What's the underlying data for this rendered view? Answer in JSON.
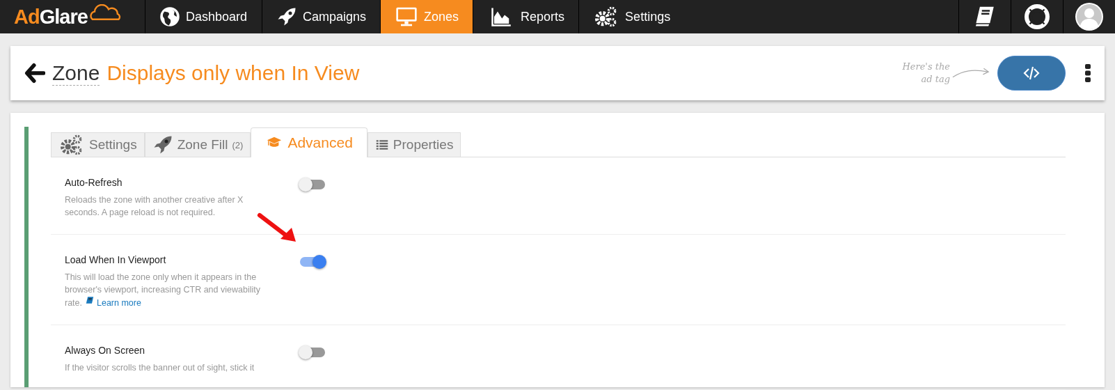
{
  "navbar": {
    "logo": {
      "part_1": "Ad",
      "part_2": "Glare"
    },
    "items": [
      {
        "label": "Dashboard",
        "selected": false
      },
      {
        "label": "Campaigns",
        "selected": false
      },
      {
        "label": "Zones",
        "selected": true
      },
      {
        "label": "Reports",
        "selected": false
      },
      {
        "label": "Settings",
        "selected": false
      }
    ]
  },
  "header": {
    "prefix": "Zone",
    "title": "Displays only when In View",
    "hint": "Here's the ad tag"
  },
  "tabs": [
    {
      "label": "Settings",
      "selected": false
    },
    {
      "label": "Zone Fill",
      "count": "(2)",
      "selected": false
    },
    {
      "label": "Advanced",
      "selected": true
    },
    {
      "label": "Properties",
      "selected": false
    }
  ],
  "settings": [
    {
      "kind": "toggle",
      "label": "Auto-Refresh",
      "description": "Reloads the zone with another creative after X seconds. A page reload is not required.",
      "on": false
    },
    {
      "kind": "toggle",
      "label": "Load When In Viewport",
      "description": "This will load the zone only when it appears in the browser's viewport, increasing CTR and viewability rate.",
      "link": "Learn more",
      "on": true,
      "annotated": true
    },
    {
      "kind": "toggle",
      "label": "Always On Screen",
      "description": "If the visitor scrolls the banner out of sight, stick it",
      "on": false
    }
  ]
}
